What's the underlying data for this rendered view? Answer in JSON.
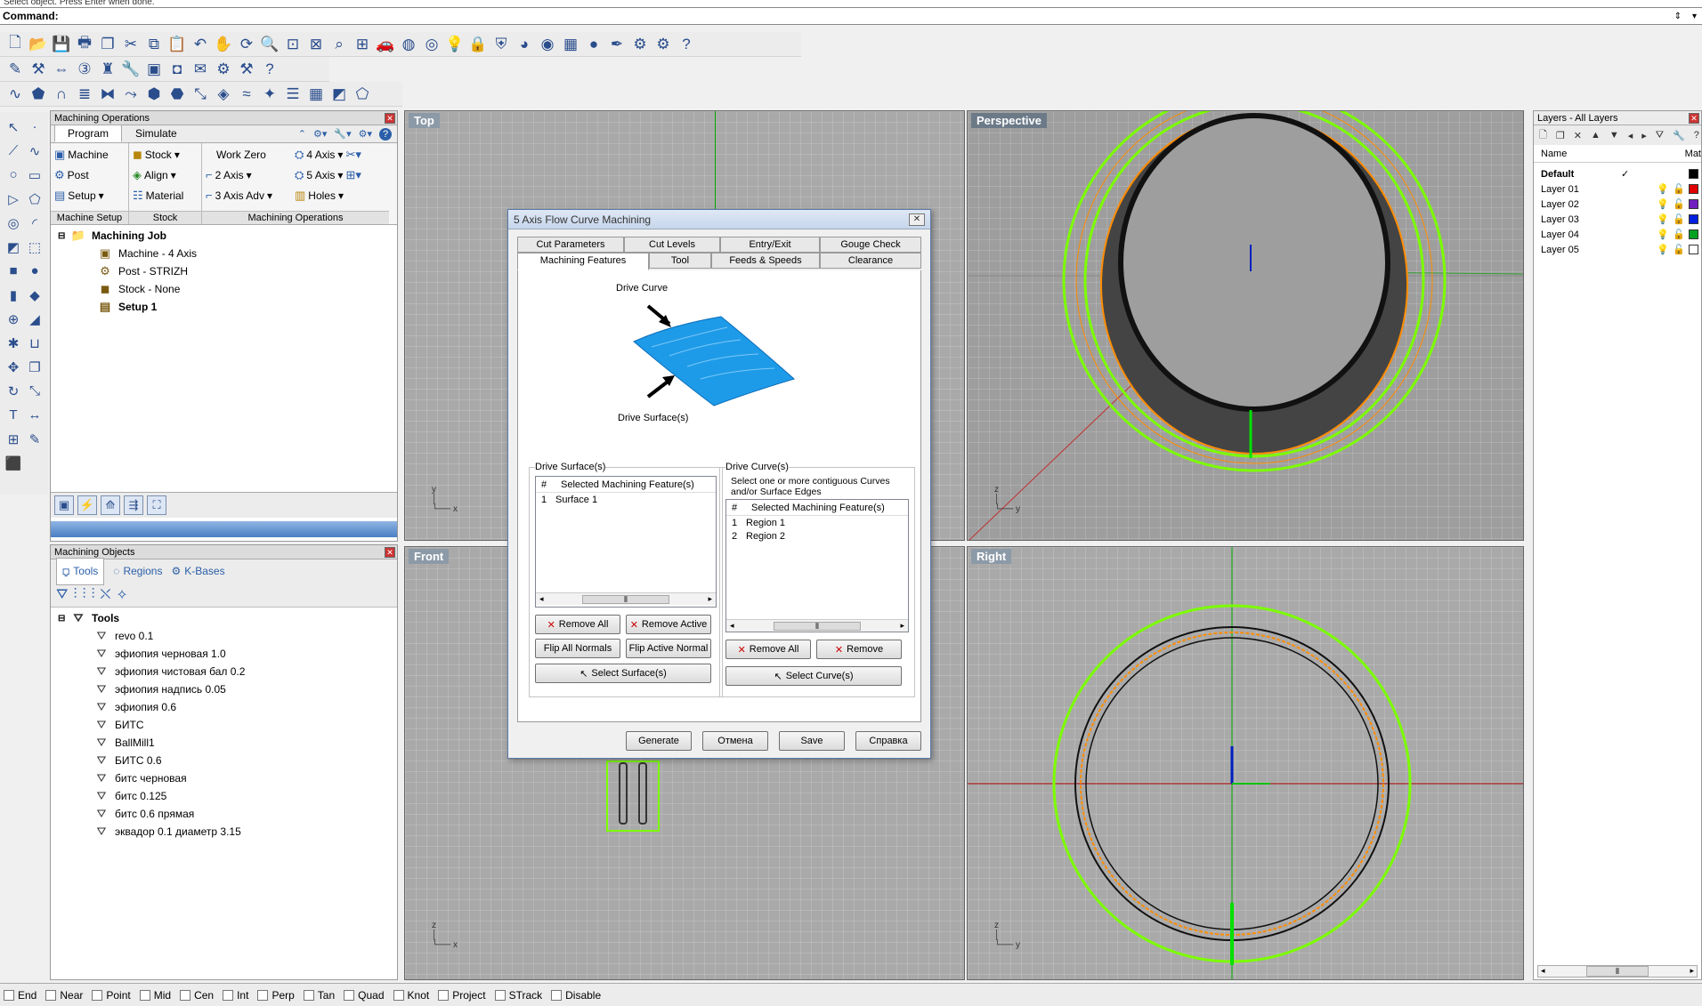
{
  "command": {
    "history": "Select object. Press Enter when done.",
    "label": "Command:",
    "value": ""
  },
  "toolbar_icons": {
    "row1": [
      "new",
      "open",
      "save",
      "print",
      "page",
      "cut",
      "copy",
      "paste",
      "undo",
      "pan",
      "rotate",
      "zoom-in",
      "zoom-window",
      "zoom-extents",
      "zoom-selected",
      "four-views",
      "car",
      "render",
      "target",
      "light",
      "lock",
      "shield",
      "color-wheel",
      "sphere",
      "grid",
      "ball",
      "pen",
      "settings",
      "gears",
      "help"
    ],
    "row2": [
      "pencil",
      "hammer",
      "dim",
      "3d",
      "chess",
      "wrench",
      "box",
      "cup",
      "mail",
      "gear",
      "tools",
      "help"
    ],
    "row3": [
      "curve",
      "paint",
      "arch",
      "stack",
      "mirror",
      "sweep",
      "cube",
      "slab",
      "scale",
      "drop",
      "flow",
      "sparkle",
      "layers",
      "grid",
      "surface",
      "fin"
    ]
  },
  "machining_ops": {
    "title": "Machining Operations",
    "tabs": [
      "Program",
      "Simulate"
    ],
    "active_tab": "Program",
    "groups": [
      {
        "label": "Machine Setup",
        "items": [
          [
            "Machine",
            "Post",
            "Setup"
          ]
        ]
      },
      {
        "label": "Stock",
        "items": [
          [
            "Stock",
            "Align",
            "Material"
          ]
        ]
      },
      {
        "label": "Machining Operations",
        "items": [
          [
            "Work Zero",
            "2 Axis",
            "3 Axis Adv"
          ],
          [
            "4 Axis",
            "5 Axis",
            "Holes"
          ]
        ]
      }
    ],
    "tree": [
      {
        "label": "Machining Job",
        "bold": true,
        "level": 0
      },
      {
        "label": "Machine - 4 Axis",
        "bold": false,
        "level": 1
      },
      {
        "label": "Post - STRIZH",
        "bold": false,
        "level": 1
      },
      {
        "label": "Stock - None",
        "bold": false,
        "level": 1
      },
      {
        "label": "Setup 1",
        "bold": true,
        "level": 1
      }
    ]
  },
  "machining_objects": {
    "title": "Machining Objects",
    "tabs": [
      "Tools",
      "Regions",
      "K-Bases"
    ],
    "root": "Tools",
    "tools": [
      "revo 0.1",
      "эфиопия черновая 1.0",
      "эфиопия чистовая бал 0.2",
      "эфиопия надпись 0.05",
      "эфиопия 0.6",
      "БИТС",
      "BallMill1",
      "БИТС 0.6",
      "битс черновая",
      "битс 0.125",
      "битс 0.6 прямая",
      "эквадор 0.1 диаметр 3.15"
    ]
  },
  "viewports": {
    "top": "Top",
    "front": "Front",
    "perspective": "Perspective",
    "right": "Right"
  },
  "dialog": {
    "title": "5 Axis Flow Curve Machining",
    "tabs_row1": [
      "Cut Parameters",
      "Cut Levels",
      "Entry/Exit",
      "Gouge Check"
    ],
    "tabs_row2": [
      "Machining Features",
      "Tool",
      "Feeds & Speeds",
      "Clearance"
    ],
    "active_tab": "Machining Features",
    "diagram": {
      "drive_curve": "Drive Curve",
      "drive_surface": "Drive Surface(s)"
    },
    "surfaces": {
      "legend": "Drive Surface(s)",
      "col_num": "#",
      "col_name": "Selected Machining Feature(s)",
      "rows": [
        {
          "n": "1",
          "name": "Surface 1"
        }
      ],
      "remove_all": "Remove All",
      "remove_active": "Remove Active",
      "flip_all": "Flip All Normals",
      "flip_active": "Flip Active Normal",
      "select": "Select Surface(s)"
    },
    "curves": {
      "legend": "Drive Curve(s)",
      "hint": "Select one or more contiguous Curves and/or Surface Edges",
      "col_num": "#",
      "col_name": "Selected Machining Feature(s)",
      "rows": [
        {
          "n": "1",
          "name": "Region 1"
        },
        {
          "n": "2",
          "name": "Region 2"
        }
      ],
      "remove_all": "Remove All",
      "remove": "Remove",
      "select": "Select Curve(s)"
    },
    "buttons": {
      "generate": "Generate",
      "cancel": "Отмена",
      "save": "Save",
      "help": "Справка"
    }
  },
  "layers": {
    "title": "Layers - All Layers",
    "col_name": "Name",
    "col_mat": "Mat",
    "rows": [
      {
        "name": "Default",
        "current": true,
        "color": "#000000"
      },
      {
        "name": "Layer 01",
        "current": false,
        "color": "#e00000"
      },
      {
        "name": "Layer 02",
        "current": false,
        "color": "#7020c0"
      },
      {
        "name": "Layer 03",
        "current": false,
        "color": "#0020e0"
      },
      {
        "name": "Layer 04",
        "current": false,
        "color": "#00a020"
      },
      {
        "name": "Layer 05",
        "current": false,
        "color": "#ffffff"
      }
    ]
  },
  "osnaps": [
    "End",
    "Near",
    "Point",
    "Mid",
    "Cen",
    "Int",
    "Perp",
    "Tan",
    "Quad",
    "Knot",
    "Project",
    "STrack",
    "Disable"
  ],
  "colors": {
    "accent": "#2a5ea8",
    "curve_green": "#7cff00",
    "curve_orange": "#ff8c00",
    "surface_blue": "#1e9be8"
  }
}
